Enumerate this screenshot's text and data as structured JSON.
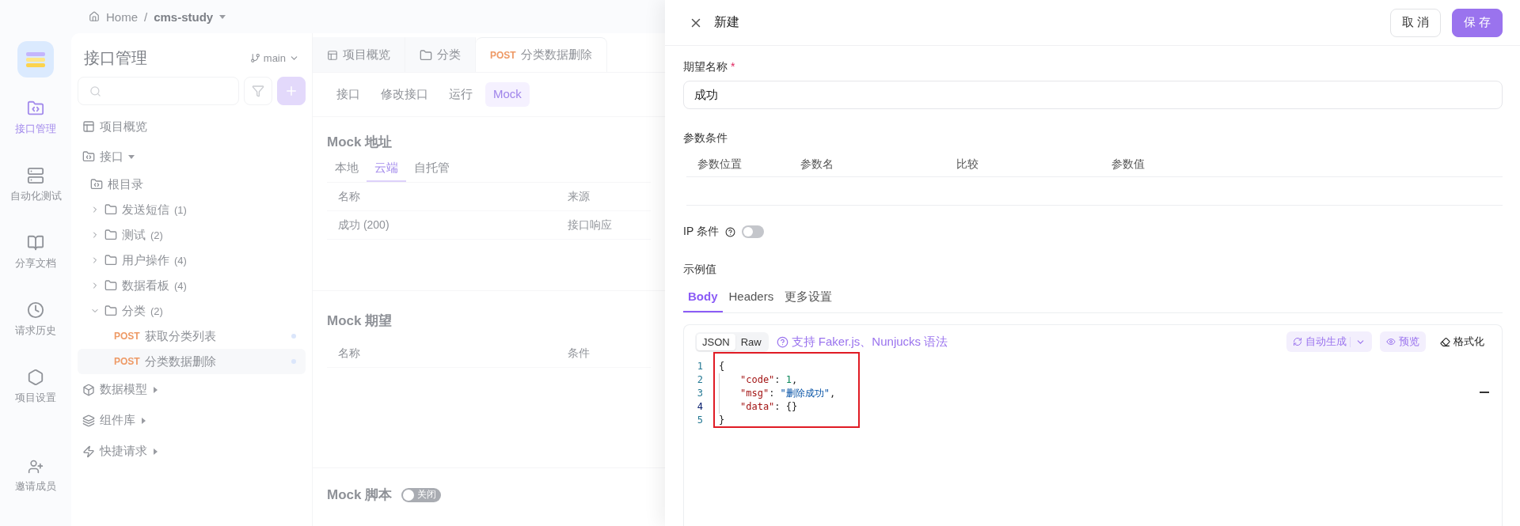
{
  "breadcrumb": [
    {
      "label": "Home",
      "kind": "home"
    },
    {
      "separator": "/",
      "label": "cms-study",
      "kind": "project"
    }
  ],
  "rail": {
    "items": [
      {
        "label": "接口管理",
        "selected": true
      },
      {
        "label": "自动化测试",
        "selected": false
      },
      {
        "label": "分享文档",
        "selected": false
      },
      {
        "label": "请求历史",
        "selected": false
      },
      {
        "label": "项目设置",
        "selected": false
      }
    ],
    "invite": "邀请成员"
  },
  "tree_panel": {
    "title": "接口管理",
    "branch": "main",
    "nodes": [
      {
        "kind": "overview",
        "label": "项目概览"
      },
      {
        "kind": "section",
        "label": "接口",
        "expanded": true,
        "children": [
          {
            "kind": "root",
            "label": "根目录",
            "children": [
              {
                "kind": "folder",
                "label": "发送短信",
                "count": "(1)",
                "expanded": false
              },
              {
                "kind": "folder",
                "label": "测试",
                "count": "(2)",
                "expanded": false
              },
              {
                "kind": "folder",
                "label": "用户操作",
                "count": "(4)",
                "expanded": false
              },
              {
                "kind": "folder",
                "label": "数据看板",
                "count": "(4)",
                "expanded": false
              },
              {
                "kind": "folder",
                "label": "分类",
                "count": "(2)",
                "expanded": true,
                "children": [
                  {
                    "kind": "endpoint",
                    "method": "POST",
                    "label": "获取分类列表",
                    "selected": false
                  },
                  {
                    "kind": "endpoint",
                    "method": "POST",
                    "label": "分类数据删除",
                    "selected": true
                  }
                ]
              }
            ]
          }
        ]
      },
      {
        "kind": "model",
        "label": "数据模型",
        "expanded": false
      },
      {
        "kind": "library",
        "label": "组件库",
        "expanded": false
      },
      {
        "kind": "quick",
        "label": "快捷请求",
        "expanded": false
      }
    ]
  },
  "doc_tabs": [
    {
      "kind": "overview",
      "label": "项目概览",
      "selected": false
    },
    {
      "kind": "folder",
      "label": "分类",
      "selected": false
    },
    {
      "kind": "endpoint",
      "method": "POST",
      "label": "分类数据删除",
      "selected": true
    }
  ],
  "sub_tabs": [
    {
      "label": "接口",
      "selected": false
    },
    {
      "label": "修改接口",
      "selected": false
    },
    {
      "label": "运行",
      "selected": false
    },
    {
      "label": "Mock",
      "selected": true
    }
  ],
  "mock_address": {
    "title": "Mock 地址",
    "tabs": [
      {
        "label": "本地",
        "selected": false
      },
      {
        "label": "云端",
        "selected": true
      },
      {
        "label": "自托管",
        "selected": false
      }
    ],
    "columns": [
      "名称",
      "来源"
    ],
    "rows": [
      [
        "成功 (200)",
        "接口响应"
      ]
    ]
  },
  "mock_expectation": {
    "title": "Mock 期望",
    "columns": [
      "名称",
      "条件"
    ]
  },
  "mock_script": {
    "title": "Mock 脚本",
    "toggle": {
      "on": false,
      "label": "关闭"
    }
  },
  "drawer": {
    "title": "新建",
    "buttons": [
      {
        "label": "取 消",
        "kind": "secondary"
      },
      {
        "label": "保 存",
        "kind": "primary"
      }
    ],
    "name_field": {
      "label": "期望名称",
      "required_mark": "*",
      "value": "成功"
    },
    "conditions": {
      "title": "参数条件",
      "columns": [
        "参数位置",
        "参数名",
        "比较",
        "参数值"
      ]
    },
    "ip_condition": {
      "label": "IP 条件",
      "on": false
    },
    "example": {
      "title": "示例值",
      "tabs": [
        {
          "label": "Body",
          "selected": true
        },
        {
          "label": "Headers",
          "selected": false
        },
        {
          "label": "更多设置",
          "selected": false
        }
      ],
      "formats": [
        {
          "label": "JSON",
          "selected": true
        },
        {
          "label": "Raw",
          "selected": false
        }
      ],
      "hint": "支持 Faker.js、Nunjucks 语法",
      "actions": [
        {
          "label": "自动生成",
          "kind": "split"
        },
        {
          "label": "预览",
          "kind": "tinted"
        },
        {
          "label": "格式化",
          "kind": "plain"
        }
      ],
      "code": [
        {
          "number": "1",
          "tokens": [
            {
              "kind": "punct",
              "text": "{"
            }
          ]
        },
        {
          "number": "2",
          "tokens": [
            {
              "kind": "key",
              "text": "\"code\""
            },
            {
              "kind": "punct",
              "text": ": "
            },
            {
              "kind": "number",
              "text": "1"
            },
            {
              "kind": "punct",
              "text": ","
            }
          ]
        },
        {
          "number": "3",
          "tokens": [
            {
              "kind": "key",
              "text": "\"msg\""
            },
            {
              "kind": "punct",
              "text": ": "
            },
            {
              "kind": "string",
              "text": "\"删除成功\""
            },
            {
              "kind": "punct",
              "text": ","
            }
          ]
        },
        {
          "number": "4",
          "tokens": [
            {
              "kind": "key",
              "text": "\"data\""
            },
            {
              "kind": "punct",
              "text": ": {}"
            }
          ]
        },
        {
          "number": "5",
          "tokens": [
            {
              "kind": "punct",
              "text": "}"
            }
          ]
        }
      ]
    }
  }
}
